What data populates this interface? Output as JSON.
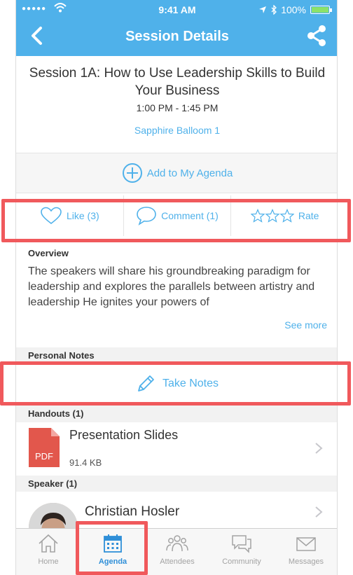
{
  "status": {
    "time": "9:41 AM",
    "battery": "100%"
  },
  "header": {
    "title": "Session Details"
  },
  "session": {
    "title": "Session 1A: How to Use Leadership Skills to Build Your Business",
    "time": "1:00 PM - 1:45 PM",
    "room": "Sapphire Balloom 1"
  },
  "agenda_label": "Add to My Agenda",
  "actions": {
    "like": "Like (3)",
    "comment": "Comment (1)",
    "rate": "Rate"
  },
  "overview": {
    "heading": "Overview",
    "text": "The speakers will share his groundbreaking paradigm for leadership and explores the parallels between artistry and leadership He ignites your powers of",
    "see_more": "See more"
  },
  "notes": {
    "heading": "Personal Notes",
    "take_notes": "Take Notes"
  },
  "handouts": {
    "heading": "Handouts  (1)",
    "items": [
      {
        "title": "Presentation Slides",
        "size": "91.4 KB",
        "badge": "PDF"
      }
    ]
  },
  "speaker": {
    "heading": "Speaker  (1)",
    "name": "Christian Hosler"
  },
  "tabs": [
    {
      "label": "Home",
      "icon": "home-icon"
    },
    {
      "label": "Agenda",
      "icon": "calendar-icon"
    },
    {
      "label": "Attendees",
      "icon": "people-icon"
    },
    {
      "label": "Community",
      "icon": "chat-icon"
    },
    {
      "label": "Messages",
      "icon": "envelope-icon"
    }
  ],
  "colors": {
    "accent": "#4fb1ea",
    "highlight": "#f0595c",
    "pdf": "#e2574c"
  }
}
